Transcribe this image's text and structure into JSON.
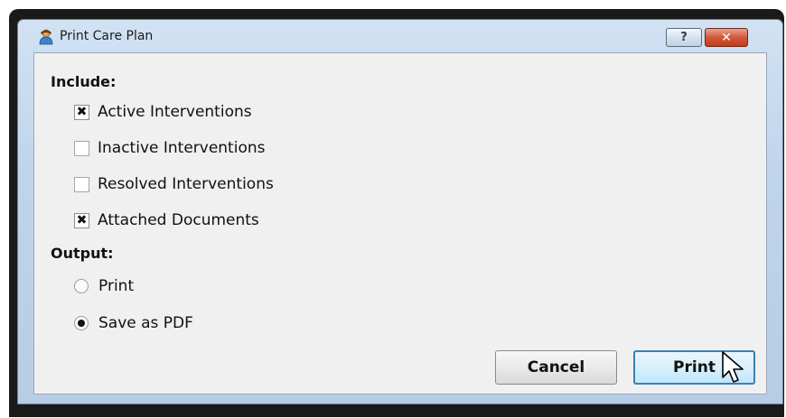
{
  "window": {
    "title": "Print Care Plan",
    "help_button": "?",
    "close_button": "✕"
  },
  "include": {
    "label": "Include:",
    "options": [
      {
        "label": "Active Interventions",
        "checked": true
      },
      {
        "label": "Inactive Interventions",
        "checked": false
      },
      {
        "label": "Resolved Interventions",
        "checked": false
      },
      {
        "label": "Attached Documents",
        "checked": true
      }
    ]
  },
  "output": {
    "label": "Output:",
    "options": [
      {
        "label": "Print",
        "selected": false
      },
      {
        "label": "Save as PDF",
        "selected": true
      }
    ]
  },
  "buttons": {
    "cancel": "Cancel",
    "print": "Print"
  }
}
